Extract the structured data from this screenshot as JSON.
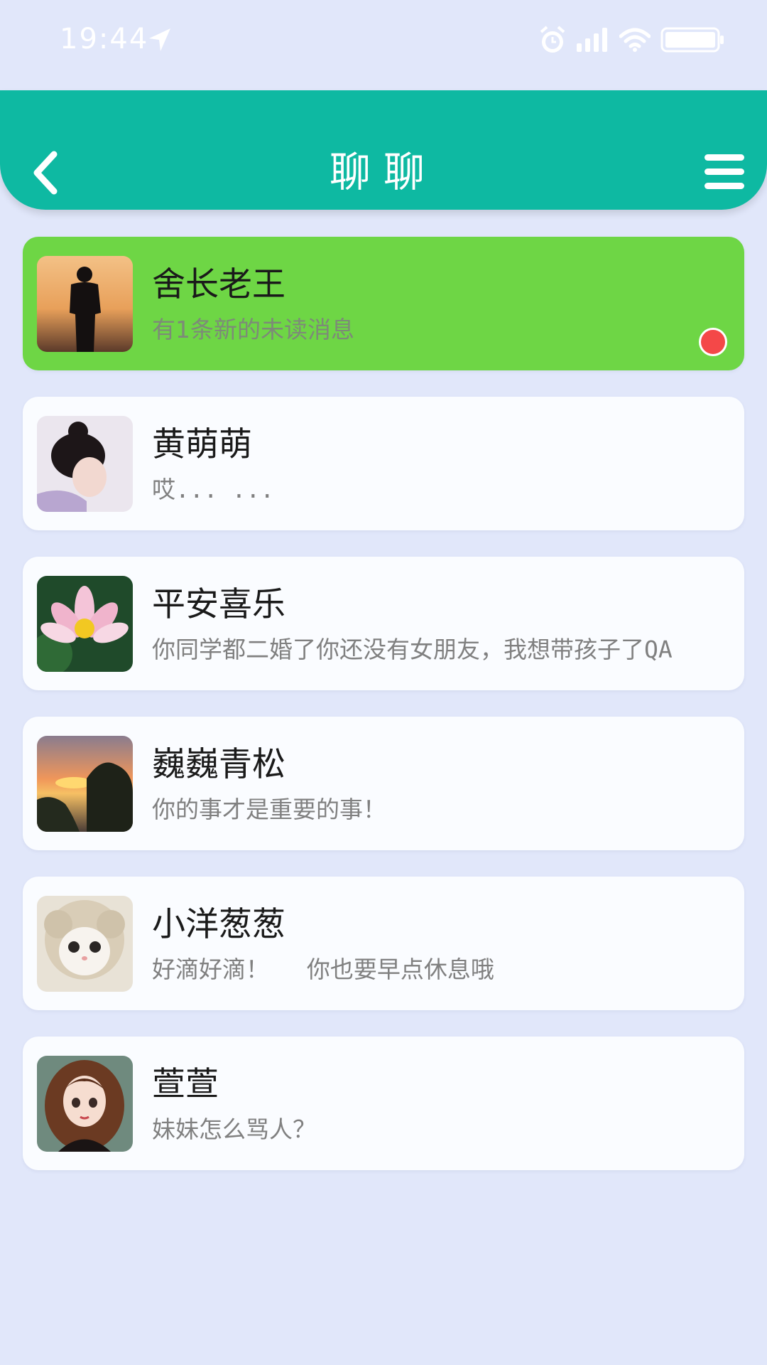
{
  "status_bar": {
    "time": "19:44",
    "icons": [
      "location-arrow-icon",
      "alarm-icon",
      "signal-icon",
      "wifi-icon",
      "battery-icon"
    ]
  },
  "header": {
    "title": "聊聊",
    "back_icon": "chevron-left-icon",
    "menu_icon": "hamburger-menu-icon",
    "color": "#0eb9a2"
  },
  "chats": [
    {
      "name": "舍长老王",
      "preview": "有1条新的未读消息",
      "unread": true,
      "avatar": "silhouette-sunset"
    },
    {
      "name": "黄萌萌",
      "preview": "哎... ...",
      "unread": false,
      "avatar": "girl-photo"
    },
    {
      "name": "平安喜乐",
      "preview": "你同学都二婚了你还没有女朋友，我想带孩子了QA",
      "unread": false,
      "avatar": "lotus-flower"
    },
    {
      "name": "巍巍青松",
      "preview": "你的事才是重要的事！",
      "unread": false,
      "avatar": "sunset-trees"
    },
    {
      "name": "小洋葱葱",
      "preview": "好滴好滴！　 你也要早点休息哦",
      "unread": false,
      "avatar": "sheep-cat"
    },
    {
      "name": "萱萱",
      "preview": "妹妹怎么骂人？",
      "unread": false,
      "avatar": "cartoon-girl"
    }
  ],
  "colors": {
    "background": "#e1e7fa",
    "unread_item": "#6ed645",
    "unread_dot": "#f44848"
  }
}
